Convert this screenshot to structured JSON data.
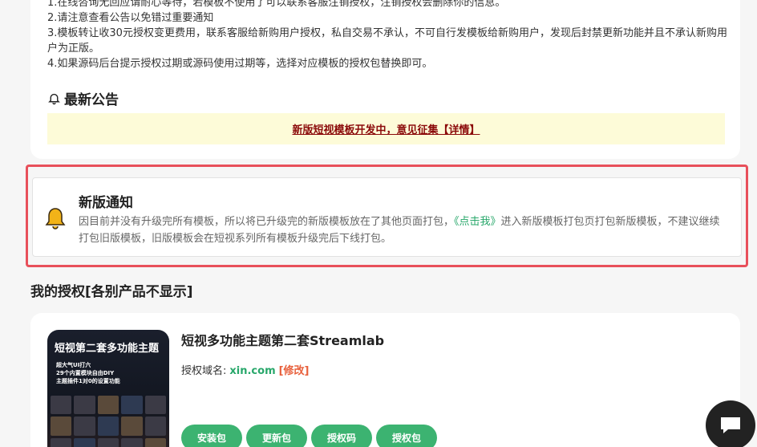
{
  "notice": {
    "lines": [
      "1.在线咨询无回应请耐心等待，若模板不使用了可以联系客服注销授权，注销授权会删除你的信息。",
      "2.请注意查看公告以免错过重要通知",
      "3.模板转让收30元授权变更费用，联系客服给新购用户授权，私自交易不承认，不可自行发模板给新购用户，发现后封禁更新功能并且不承认新购用户为正版。",
      "4.如果源码后台提示授权过期或源码使用过期等，选择对应模板的授权包替换即可。"
    ]
  },
  "announcement": {
    "title": "最新公告",
    "link_text": "新版短视模板开发中，意见征集【详情】"
  },
  "new_notice": {
    "title": "新版通知",
    "body_before": "因目前并没有升级完所有模板，所以将已升级完的新版模板放在了其他页面打包，",
    "link": "《点击我》",
    "body_after": "进入新版模板打包页打包新版模板，不建议继续打包旧版模板，旧版模板会在短视系列所有模板升级完后下线打包。"
  },
  "auth": {
    "section_title": "我的授权[各别产品不显示]",
    "product": {
      "thumb_title": "短视第二套多功能主题",
      "thumb_sub": [
        "超大气UI打六",
        "29个内置模块自由DIY",
        "主题插件1对0的设置功能"
      ],
      "name": "短视多功能主题第二套Streamlab",
      "domain_label": "授权域名:",
      "domain": "xin.com",
      "edit": "[修改]",
      "buttons": [
        "安装包",
        "更新包",
        "授权码",
        "授权包"
      ]
    }
  },
  "icons": {
    "bell": "bell-icon",
    "chat": "chat-icon"
  },
  "colors": {
    "accent": "#3cb371",
    "highlight": "#e8505b",
    "link_red": "#8b0a0a",
    "edit": "#e8603c",
    "bell": "#f2b318"
  }
}
